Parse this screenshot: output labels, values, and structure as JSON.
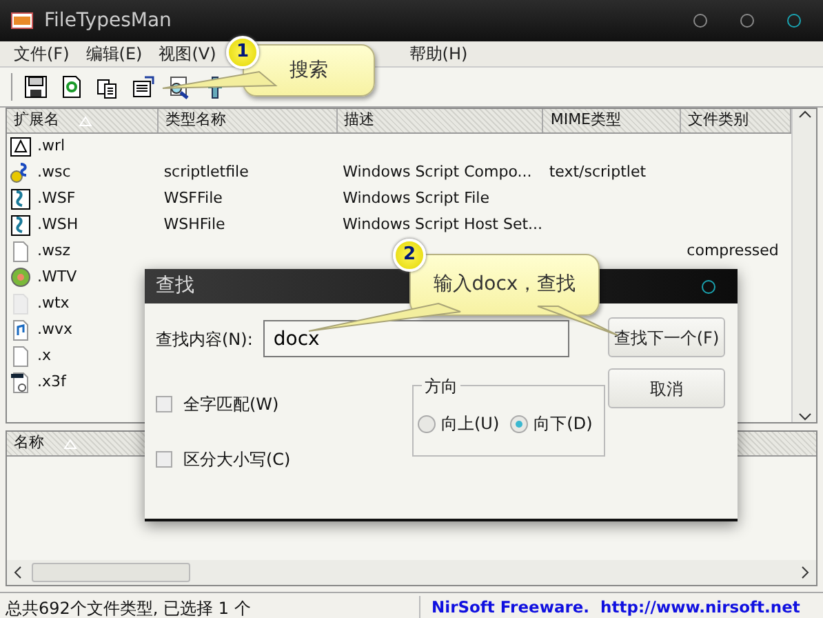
{
  "window": {
    "title": "FileTypesMan"
  },
  "menu": [
    {
      "label": "文件(F)"
    },
    {
      "label": "编辑(E)"
    },
    {
      "label": "视图(V)"
    },
    {
      "label": "帮助(H)"
    }
  ],
  "list": {
    "columns": [
      {
        "label": "扩展名",
        "sorted": true
      },
      {
        "label": "类型名称",
        "sorted": false
      },
      {
        "label": "描述",
        "sorted": false
      },
      {
        "label": "MIME类型",
        "sorted": false
      },
      {
        "label": "文件类别",
        "sorted": false
      }
    ],
    "rows": [
      {
        "kind": "vrml",
        "extension": ".wrl"
      },
      {
        "kind": "gear-script",
        "extension": ".wsc",
        "type_name": "scriptletfile",
        "description": "Windows Script Compo...",
        "mime_type": "text/scriptlet"
      },
      {
        "kind": "script",
        "extension": ".WSF",
        "type_name": "WSFFile",
        "description": "Windows Script File"
      },
      {
        "kind": "script",
        "extension": ".WSH",
        "type_name": "WSHFile",
        "description": "Windows Script Host Set..."
      },
      {
        "kind": "blank",
        "extension": ".wsz",
        "category": "compressed"
      },
      {
        "kind": "media",
        "extension": ".WTV"
      },
      {
        "kind": "faded",
        "extension": ".wtx"
      },
      {
        "kind": "audio",
        "extension": ".wvx"
      },
      {
        "kind": "blank",
        "extension": ".x"
      },
      {
        "kind": "image",
        "extension": ".x3f"
      }
    ]
  },
  "lower_pane": {
    "columns": [
      {
        "label": "名称",
        "sorted": true
      }
    ]
  },
  "dialog": {
    "title": "查找",
    "find_label": "查找内容(N):",
    "find_value": "docx",
    "checkboxes": [
      {
        "label": "全字匹配(W)",
        "checked": false
      },
      {
        "label": "区分大小写(C)",
        "checked": false
      }
    ],
    "direction": {
      "label": "方向",
      "options": [
        {
          "label": "向上(U)",
          "selected": false
        },
        {
          "label": "向下(D)",
          "selected": true
        }
      ]
    },
    "buttons": [
      "查找下一个(F)",
      "取消"
    ]
  },
  "callouts": [
    {
      "number": "1",
      "text": "搜索"
    },
    {
      "number": "2",
      "text": "输入docx，查找"
    }
  ],
  "status_bar": {
    "summary": "总共692个文件类型, 已选择 1 个",
    "credit": "NirSoft Freeware.  http://www.nirsoft.net"
  }
}
